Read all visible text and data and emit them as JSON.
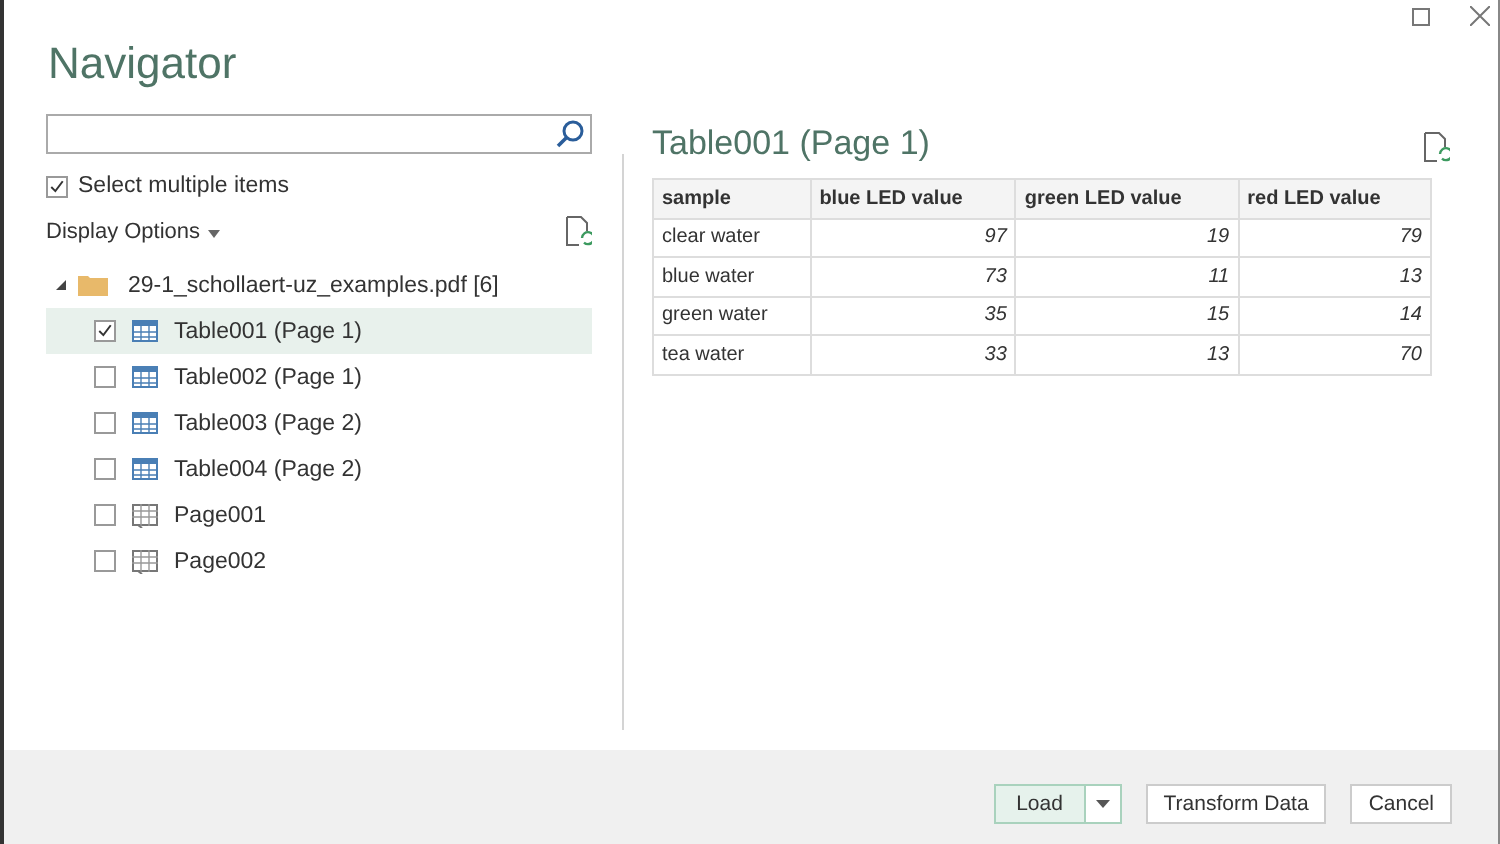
{
  "window": {
    "title": "Navigator"
  },
  "select_multiple": {
    "label": "Select multiple items",
    "checked": true
  },
  "display_options": {
    "label": "Display Options"
  },
  "tree": {
    "label": "29-1_schollaert-uz_examples.pdf [6]",
    "expanded": true,
    "children": [
      {
        "label": "Table001 (Page 1)",
        "kind": "table",
        "checked": true,
        "selected": true
      },
      {
        "label": "Table002 (Page 1)",
        "kind": "table",
        "checked": false,
        "selected": false
      },
      {
        "label": "Table003 (Page 2)",
        "kind": "table",
        "checked": false,
        "selected": false
      },
      {
        "label": "Table004 (Page 2)",
        "kind": "table",
        "checked": false,
        "selected": false
      },
      {
        "label": "Page001",
        "kind": "page",
        "checked": false,
        "selected": false
      },
      {
        "label": "Page002",
        "kind": "page",
        "checked": false,
        "selected": false
      }
    ]
  },
  "preview": {
    "title": "Table001 (Page 1)",
    "columns": [
      {
        "label": "sample",
        "kind": "text"
      },
      {
        "label": "blue LED value",
        "kind": "number"
      },
      {
        "label": "green LED value",
        "kind": "number"
      },
      {
        "label": "red LED value",
        "kind": "number"
      }
    ],
    "rows": [
      [
        "clear water",
        "97",
        "19",
        "79"
      ],
      [
        "blue water",
        "73",
        "11",
        "13"
      ],
      [
        "green water",
        "35",
        "15",
        "14"
      ],
      [
        "tea water",
        "33",
        "13",
        "70"
      ]
    ]
  },
  "buttons": [
    {
      "label": "Load",
      "kind": "split"
    },
    {
      "label": "Transform Data",
      "kind": "plain"
    },
    {
      "label": "Cancel",
      "kind": "plain"
    }
  ]
}
